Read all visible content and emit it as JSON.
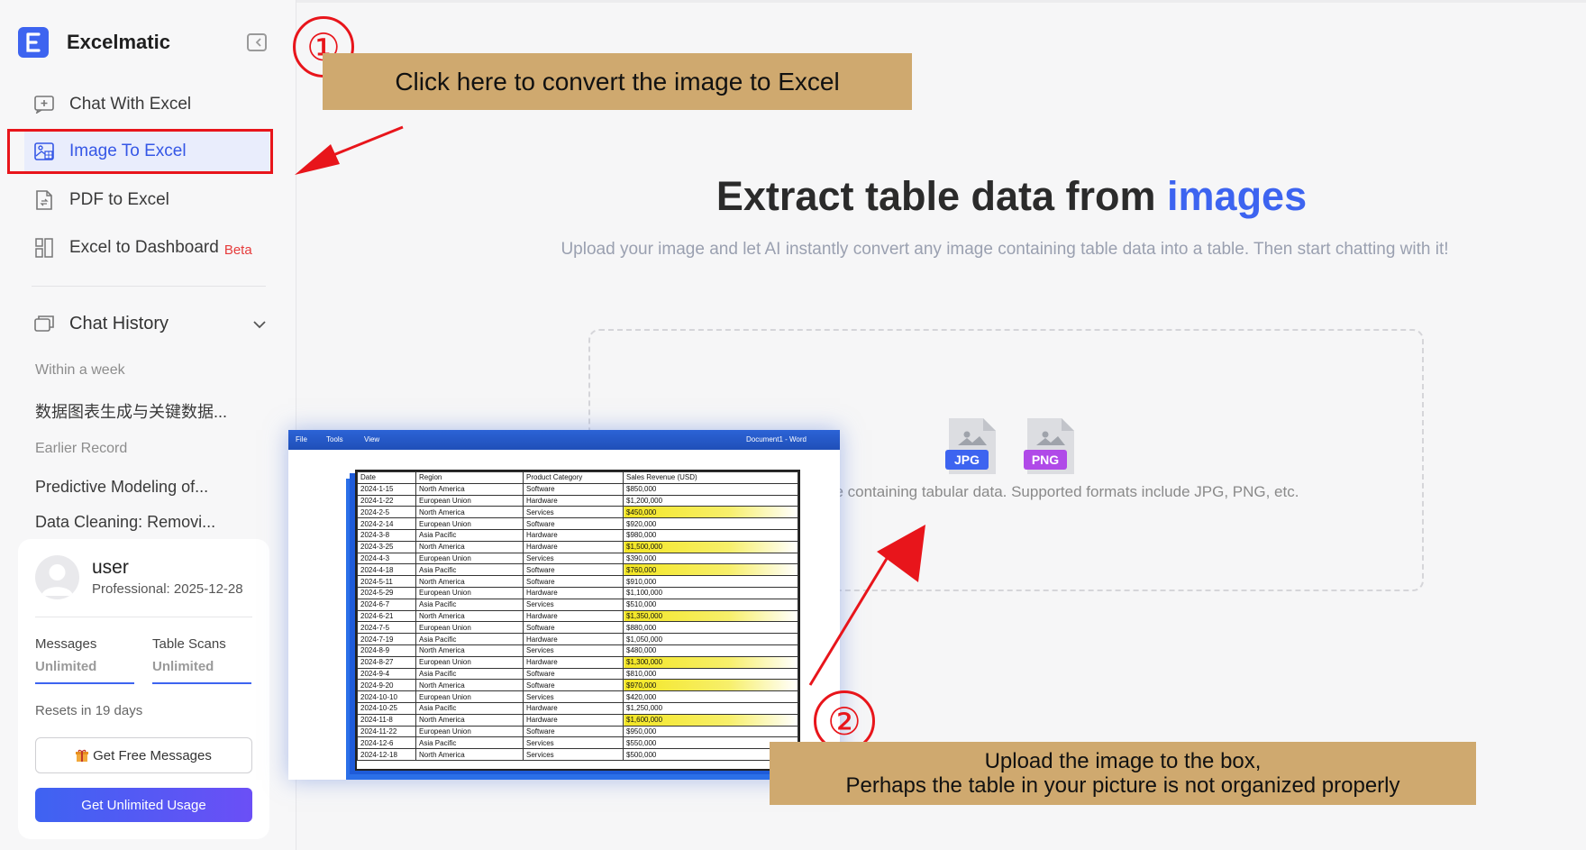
{
  "app": {
    "name": "Excelmatic"
  },
  "sidebar": {
    "nav": [
      {
        "label": "Chat With Excel",
        "icon": "chat-plus-icon"
      },
      {
        "label": "Image To Excel",
        "icon": "image-table-icon",
        "active": true
      },
      {
        "label": "PDF to Excel",
        "icon": "pdf-file-icon"
      },
      {
        "label": "Excel to Dashboard",
        "icon": "dashboard-icon",
        "badge": "Beta"
      }
    ],
    "history": {
      "title": "Chat History",
      "groups": [
        {
          "label": "Within a week",
          "items": [
            "数据图表生成与关键数据..."
          ]
        },
        {
          "label": "Earlier Record",
          "items": [
            "Predictive Modeling of...",
            "Data Cleaning: Removi..."
          ]
        }
      ]
    },
    "user_card": {
      "name": "user",
      "plan": "Professional: 2025-12-28",
      "messages_label": "Messages",
      "messages_value": "Unlimited",
      "scans_label": "Table Scans",
      "scans_value": "Unlimited",
      "resets": "Resets in 19 days",
      "free_button": "Get Free Messages",
      "unlimited_button": "Get Unlimited Usage"
    }
  },
  "main": {
    "headline_prefix": "Extract table data from ",
    "headline_accent": "images",
    "subline": "Upload your image and let AI instantly convert any image containing table data into a table. Then start chatting with it!",
    "dropzone": {
      "hint": "ge containing tabular data. Supported formats include JPG, PNG, etc.",
      "formats": [
        "JPG",
        "PNG"
      ]
    }
  },
  "annotations": {
    "step1_number": "①",
    "step1_text": "Click here to convert the image to Excel",
    "step2_number": "②",
    "step2_line1": "Upload the image to the box,",
    "step2_line2": "Perhaps the table in your picture is not organized properly",
    "color_red": "#e8151b",
    "color_callout": "#cfa96f"
  },
  "screenshot": {
    "menu": [
      "File",
      "Tools",
      "View"
    ],
    "doc_title": "Document1 - Word",
    "headers": [
      "Date",
      "Region",
      "Product Category",
      "Sales Revenue (USD)"
    ],
    "rows": [
      [
        "2024-1-15",
        "North America",
        "Software",
        "$850,000",
        false
      ],
      [
        "2024-1-22",
        "European Union",
        "Hardware",
        "$1,200,000",
        false
      ],
      [
        "2024-2-5",
        "North America",
        "Services",
        "$450,000",
        true
      ],
      [
        "2024-2-14",
        "European Union",
        "Software",
        "$920,000",
        false
      ],
      [
        "2024-3-8",
        "Asia Pacific",
        "Hardware",
        "$980,000",
        false
      ],
      [
        "2024-3-25",
        "North America",
        "Hardware",
        "$1,500,000",
        true
      ],
      [
        "2024-4-3",
        "European Union",
        "Services",
        "$390,000",
        false
      ],
      [
        "2024-4-18",
        "Asia Pacific",
        "Software",
        "$760,000",
        true
      ],
      [
        "2024-5-11",
        "North America",
        "Software",
        "$910,000",
        false
      ],
      [
        "2024-5-29",
        "European Union",
        "Hardware",
        "$1,100,000",
        false
      ],
      [
        "2024-6-7",
        "Asia Pacific",
        "Services",
        "$510,000",
        false
      ],
      [
        "2024-6-21",
        "North America",
        "Hardware",
        "$1,350,000",
        true
      ],
      [
        "2024-7-5",
        "European Union",
        "Software",
        "$880,000",
        false
      ],
      [
        "2024-7-19",
        "Asia Pacific",
        "Hardware",
        "$1,050,000",
        false
      ],
      [
        "2024-8-9",
        "North America",
        "Services",
        "$480,000",
        false
      ],
      [
        "2024-8-27",
        "European Union",
        "Hardware",
        "$1,300,000",
        true
      ],
      [
        "2024-9-4",
        "Asia Pacific",
        "Software",
        "$810,000",
        false
      ],
      [
        "2024-9-20",
        "North America",
        "Software",
        "$970,000",
        true
      ],
      [
        "2024-10-10",
        "European Union",
        "Services",
        "$420,000",
        false
      ],
      [
        "2024-10-25",
        "Asia Pacific",
        "Hardware",
        "$1,250,000",
        false
      ],
      [
        "2024-11-8",
        "North America",
        "Hardware",
        "$1,600,000",
        true
      ],
      [
        "2024-11-22",
        "European Union",
        "Software",
        "$950,000",
        false
      ],
      [
        "2024-12-6",
        "Asia Pacific",
        "Services",
        "$550,000",
        false
      ],
      [
        "2024-12-18",
        "North America",
        "Services",
        "$500,000",
        false
      ]
    ]
  }
}
